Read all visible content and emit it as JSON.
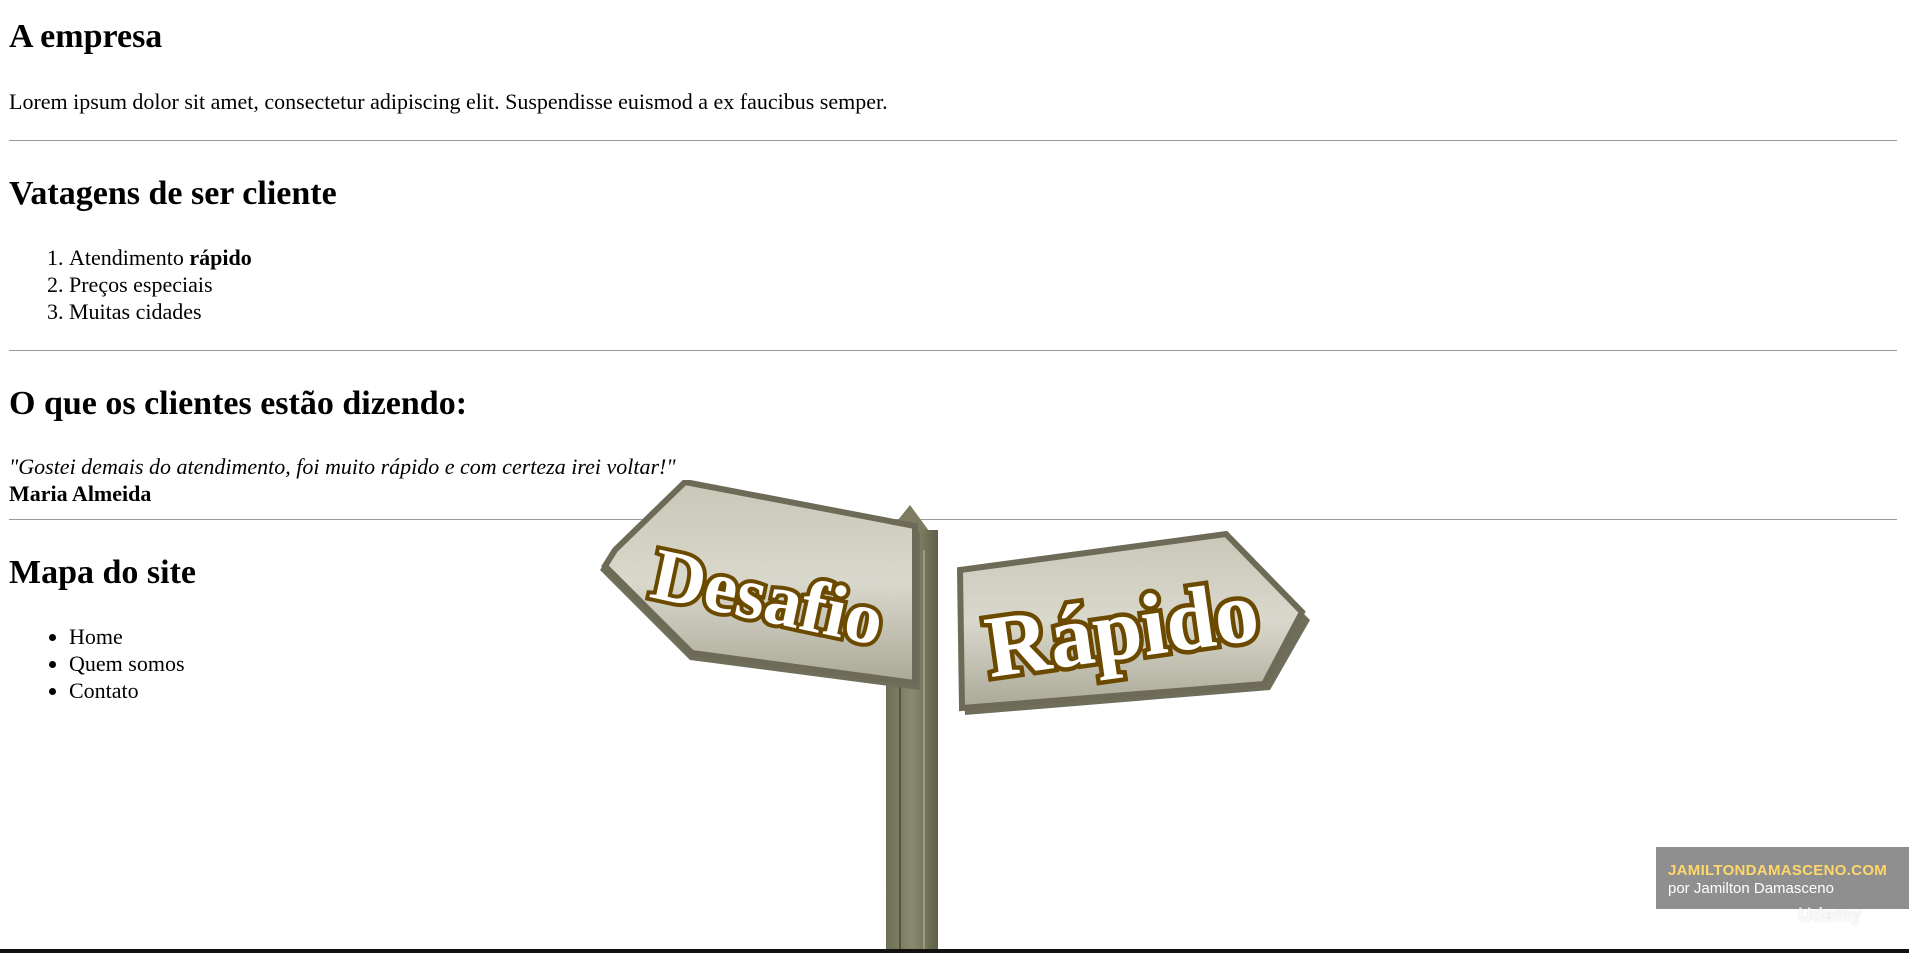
{
  "sections": {
    "company": {
      "title": "A empresa",
      "text": "Lorem ipsum dolor sit amet, consectetur adipiscing elit. Suspendisse euismod a ex faucibus semper."
    },
    "advantages": {
      "title": "Vatagens de ser cliente",
      "items": [
        {
          "text": "Atendimento ",
          "bold": "rápido"
        },
        {
          "text": "Preços especiais"
        },
        {
          "text": "Muitas cidades"
        }
      ]
    },
    "testimonials": {
      "title": "O que os clientes estão dizendo:",
      "quote": "\"Gostei demais do atendimento, foi muito rápido e com certeza irei voltar!\"",
      "author": "Maria Almeida"
    },
    "sitemap": {
      "title": "Mapa do site",
      "items": [
        "Home",
        "Quem somos",
        "Contato"
      ]
    }
  },
  "overlay": {
    "sign_left": "Desafio",
    "sign_right": "Rápido",
    "watermark_site": "JAMILTONDAMASCENO.COM",
    "watermark_by": "por Jamilton Damasceno",
    "platform": "Udemy"
  }
}
